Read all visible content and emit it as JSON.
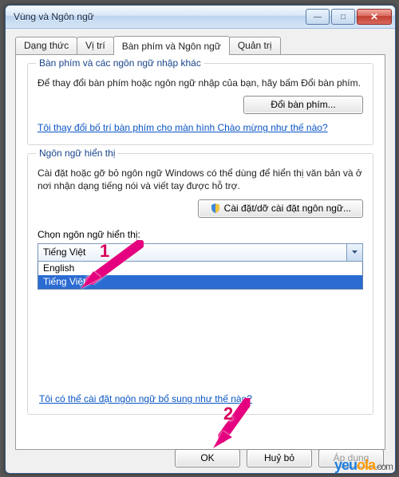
{
  "window": {
    "title": "Vùng và Ngôn ngữ"
  },
  "tabs": {
    "format": "Dạng thức",
    "location": "Vị trí",
    "keyboard": "Bàn phím và Ngôn ngữ",
    "admin": "Quản trị"
  },
  "group_keyboard": {
    "legend": "Bàn phím và các ngôn ngữ nhập khác",
    "text": "Để thay đổi bàn phím hoặc ngôn ngữ nhập của bạn, hãy bấm Đổi bàn phím.",
    "button": "Đổi bàn phím...",
    "link": "Tôi thay đổi bố trí bàn phím cho màn hình Chào mừng như thế nào?"
  },
  "group_display": {
    "legend": "Ngôn ngữ hiển thị",
    "text": "Cài đặt hoặc gỡ bỏ ngôn ngữ Windows có thể dùng để hiển thị văn bản và ở nơi nhận dạng tiếng nói và viết tay được hỗ trợ.",
    "install_button": "Cài đặt/dỡ cài đặt ngôn ngữ...",
    "choose_label": "Chọn ngôn ngữ hiển thị:",
    "combo_value": "Tiếng Việt",
    "options": {
      "english": "English",
      "viet": "Tiếng Việt"
    },
    "bottom_link": "Tôi có thể cài đặt ngôn ngữ bổ sung như thế nào?"
  },
  "footer": {
    "ok": "OK",
    "cancel": "Huỷ bỏ",
    "apply": "Áp dụng"
  },
  "annotation": {
    "one": "1",
    "two": "2"
  },
  "watermark": {
    "p1": "yeu",
    "p2": "ola",
    "suf": ".com"
  }
}
